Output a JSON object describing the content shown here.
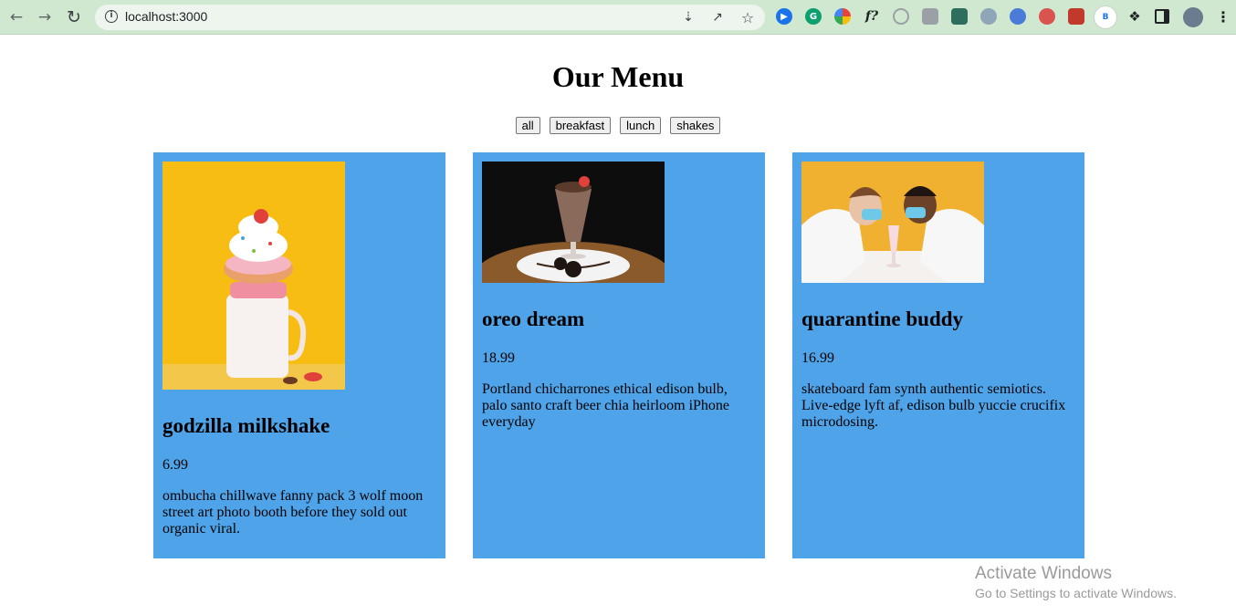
{
  "browser": {
    "url": "localhost:3000",
    "icons": {
      "back": "arrow-left-icon",
      "forward": "arrow-right-icon",
      "reload": "reload-icon",
      "info": "info-icon",
      "install": "install-icon",
      "share": "share-icon",
      "bookmark": "star-icon"
    },
    "profile_badge": "B"
  },
  "page": {
    "title": "Our Menu",
    "filters": [
      "all",
      "breakfast",
      "lunch",
      "shakes"
    ]
  },
  "menu": [
    {
      "title": "godzilla milkshake",
      "price": "6.99",
      "desc": "ombucha chillwave fanny pack 3 wolf moon street art photo booth before they sold out organic viral."
    },
    {
      "title": "oreo dream",
      "price": "18.99",
      "desc": "Portland chicharrones ethical edison bulb, palo santo craft beer chia heirloom iPhone everyday"
    },
    {
      "title": "quarantine buddy",
      "price": "16.99",
      "desc": "skateboard fam synth authentic semiotics. Live-edge lyft af, edison bulb yuccie crucifix microdosing."
    }
  ],
  "watermark": {
    "line1": "Activate Windows",
    "line2": "Go to Settings to activate Windows."
  },
  "colors": {
    "card": "#4fa3e8",
    "toolbar": "#cfe8cf"
  }
}
